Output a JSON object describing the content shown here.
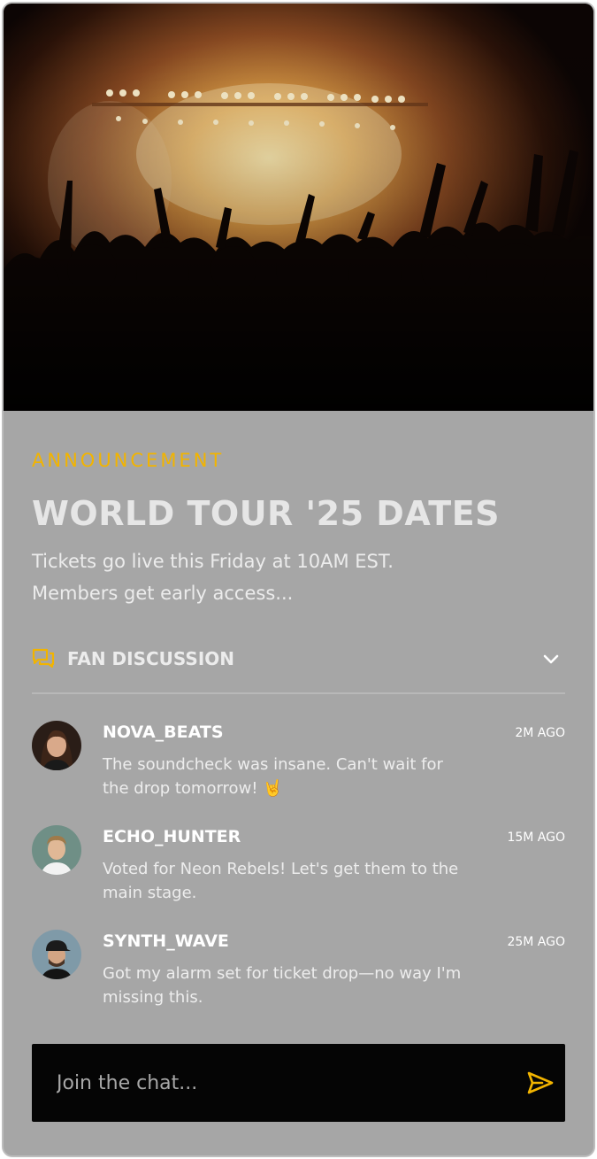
{
  "announcement": {
    "tag": "ANNOUNCEMENT",
    "title": "WORLD TOUR '25 DATES",
    "description_line1": "Tickets go live this Friday at 10AM EST.",
    "description_line2": "Members get early access..."
  },
  "discussion": {
    "label": "FAN DISCUSSION",
    "icon": "chat-bubbles-icon",
    "toggle_icon": "chevron-down-icon",
    "messages": [
      {
        "username": "NOVA_BEATS",
        "time": "2M AGO",
        "text": "The soundcheck was insane. Can't wait for the drop tomorrow!",
        "emoji": "🤘"
      },
      {
        "username": "ECHO_HUNTER",
        "time": "15M AGO",
        "text": "Voted for Neon Rebels! Let's get them to the main stage."
      },
      {
        "username": "SYNTH_WAVE",
        "time": "25M AGO",
        "text": "Got my alarm set for ticket drop—no way I'm missing this."
      }
    ]
  },
  "chat": {
    "placeholder": "Join the chat...",
    "send_icon": "send-icon"
  },
  "colors": {
    "accent": "#f2b400",
    "panel": "#a6a6a6",
    "chatbar": "#050505"
  }
}
